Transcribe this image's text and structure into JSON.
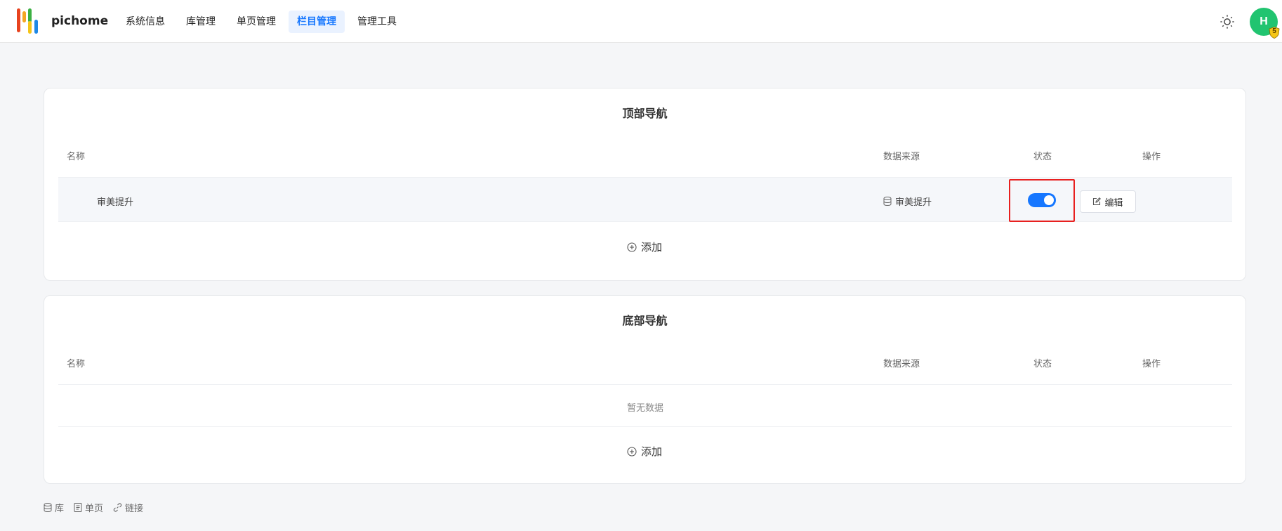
{
  "app": {
    "brand": "pichome",
    "avatar_letter": "H",
    "avatar_badge": "5"
  },
  "nav": [
    {
      "label": "系统信息",
      "active": false
    },
    {
      "label": "库管理",
      "active": false
    },
    {
      "label": "单页管理",
      "active": false
    },
    {
      "label": "栏目管理",
      "active": true
    },
    {
      "label": "管理工具",
      "active": false
    }
  ],
  "top_nav": {
    "title": "顶部导航",
    "columns": {
      "name": "名称",
      "source": "数据来源",
      "status": "状态",
      "actions": "操作"
    },
    "rows": [
      {
        "name": "审美提升",
        "source": "审美提升",
        "status": true,
        "edit_label": "编辑"
      }
    ],
    "add_label": "添加"
  },
  "bottom_nav": {
    "title": "底部导航",
    "columns": {
      "name": "名称",
      "source": "数据来源",
      "status": "状态",
      "actions": "操作"
    },
    "empty_text": "暂无数据",
    "add_label": "添加"
  },
  "footer": {
    "links": [
      "库",
      "单页",
      "链接"
    ]
  },
  "colors": {
    "accent": "#1677ff",
    "avatar": "#21c470",
    "highlight": "#e8201f"
  }
}
